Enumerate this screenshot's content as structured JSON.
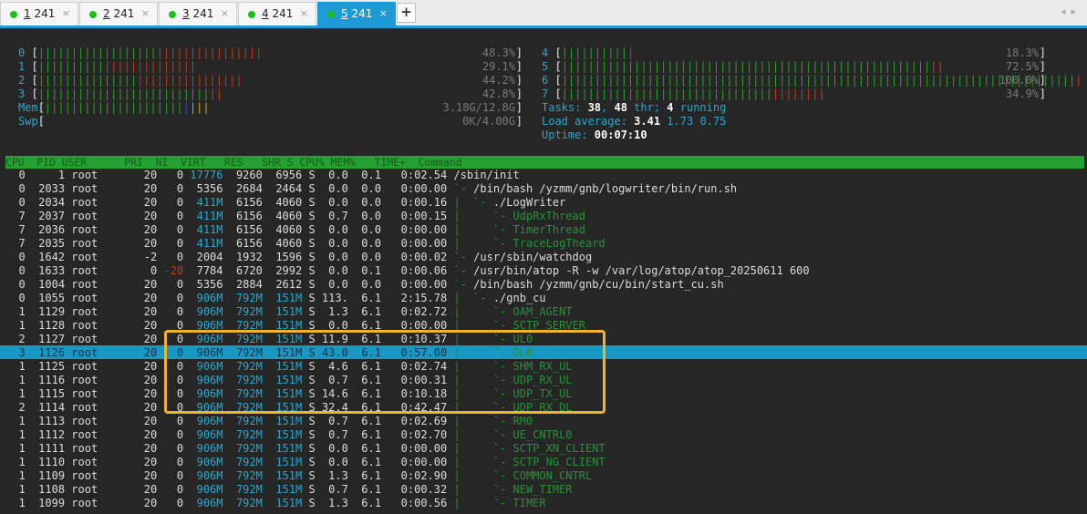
{
  "tabs": [
    {
      "num": "1",
      "name": " 241"
    },
    {
      "num": "2",
      "name": " 241"
    },
    {
      "num": "3",
      "name": " 241"
    },
    {
      "num": "4",
      "name": " 241"
    },
    {
      "num": "5",
      "name": " 241"
    }
  ],
  "active_tab": 4,
  "add_tab_label": "+",
  "scroll_arrows": "◂▸",
  "colors": {
    "accent": "#1e9ad6",
    "status_dot": "#1bc11b",
    "header_bar": "#27a033",
    "selected_row": "#1799c4",
    "highlight_box": "#f0b42a"
  },
  "cpus_left": [
    {
      "n": "0",
      "green": "||||||||||||||||||",
      "blue": "",
      "red": "||||||||||||||||",
      "yellow": "",
      "value": "48.3%"
    },
    {
      "n": "1",
      "green": "||||||||||",
      "blue": "",
      "red": "||||||||||||||",
      "yellow": "",
      "value": "29.1%"
    },
    {
      "n": "2",
      "green": "|||||||||||||||",
      "blue": "",
      "red": "||||||||||||||||",
      "yellow": "",
      "value": "44.2%"
    },
    {
      "n": "3",
      "green": "||||||||||||||||||||||||||",
      "blue": "",
      "red": "||",
      "yellow": "",
      "value": "42.8%"
    }
  ],
  "mem": {
    "label": "Mem",
    "green": "|||||||||||||||||||||",
    "blue": "|",
    "red": "",
    "yellow": "|||",
    "value": "3.18G/12.8G"
  },
  "swp": {
    "label": "Swp",
    "green": "",
    "blue": "",
    "red": "",
    "yellow": "",
    "value": "0K/4.00G"
  },
  "cpus_right": [
    {
      "n": "4",
      "green": "||||||||||",
      "blue": "",
      "red": "|",
      "yellow": "",
      "value": "18.3%"
    },
    {
      "n": "5",
      "green": "||||||||||||||||||||||||||||||||||||||||||||||||||||||||",
      "blue": "",
      "red": "||",
      "yellow": "",
      "value": "72.5%"
    },
    {
      "n": "6",
      "green": "||||||||||||||||||||||||||||||||||||||||||||||||||||||||||||||||||||||||||||||",
      "blue": "",
      "red": "|",
      "yellow": "",
      "value": "100.0%"
    },
    {
      "n": "7",
      "green": "||||||||||||||||||||||||||||||||",
      "blue": "",
      "red": "||||||||",
      "yellow": "",
      "value": "34.9%"
    }
  ],
  "tasks": {
    "label": "Tasks: ",
    "procs": "38",
    "sep": ", ",
    "threads": "48",
    "thr": " thr; ",
    "running": "4",
    "run_label": " running"
  },
  "load": {
    "label": "Load average: ",
    "one": "3.41",
    "five": "1.73",
    "fifteen": "0.75"
  },
  "uptime": {
    "label": "Uptime: ",
    "value": "00:07:10"
  },
  "header": "CPU  PID USER      PRI  NI  VIRT   RES   SHR S CPU% MEM%   TIME+  Command",
  "processes": [
    {
      "cpu": "0",
      "pid": "1",
      "user": "root",
      "pri": "20",
      "ni": "0",
      "virt": "17776",
      "res": "9260",
      "shr": "6956",
      "s": "S",
      "cpup": "0.0",
      "memp": "0.1",
      "time": "0:02.54",
      "tree": "",
      "cmd": "/sbin/init",
      "thread": false
    },
    {
      "cpu": "0",
      "pid": "2033",
      "user": "root",
      "pri": "20",
      "ni": "0",
      "virt": "5356",
      "res": "2684",
      "shr": "2464",
      "s": "S",
      "cpup": "0.0",
      "memp": "0.0",
      "time": "0:00.00",
      "tree": "`- ",
      "cmd": "/bin/bash /yzmm/gnb/logwriter/bin/run.sh",
      "thread": false
    },
    {
      "cpu": "0",
      "pid": "2034",
      "user": "root",
      "pri": "20",
      "ni": "0",
      "virt": "411M",
      "res": "6156",
      "shr": "4060",
      "s": "S",
      "cpup": "0.0",
      "memp": "0.0",
      "time": "0:00.16",
      "tree": "|  `- ",
      "cmd": "./LogWriter",
      "thread": false
    },
    {
      "cpu": "7",
      "pid": "2037",
      "user": "root",
      "pri": "20",
      "ni": "0",
      "virt": "411M",
      "res": "6156",
      "shr": "4060",
      "s": "S",
      "cpup": "0.7",
      "memp": "0.0",
      "time": "0:00.15",
      "tree": "|     `- ",
      "cmd": "UdpRxThread",
      "thread": true
    },
    {
      "cpu": "7",
      "pid": "2036",
      "user": "root",
      "pri": "20",
      "ni": "0",
      "virt": "411M",
      "res": "6156",
      "shr": "4060",
      "s": "S",
      "cpup": "0.0",
      "memp": "0.0",
      "time": "0:00.00",
      "tree": "|     `- ",
      "cmd": "TimerThread",
      "thread": true
    },
    {
      "cpu": "7",
      "pid": "2035",
      "user": "root",
      "pri": "20",
      "ni": "0",
      "virt": "411M",
      "res": "6156",
      "shr": "4060",
      "s": "S",
      "cpup": "0.0",
      "memp": "0.0",
      "time": "0:00.00",
      "tree": "|     `- ",
      "cmd": "TraceLogTheard",
      "thread": true
    },
    {
      "cpu": "0",
      "pid": "1642",
      "user": "root",
      "pri": "-2",
      "ni": "0",
      "virt": "2004",
      "res": "1932",
      "shr": "1596",
      "s": "S",
      "cpup": "0.0",
      "memp": "0.0",
      "time": "0:00.02",
      "tree": "`- ",
      "cmd": "/usr/sbin/watchdog",
      "thread": false
    },
    {
      "cpu": "0",
      "pid": "1633",
      "user": "root",
      "pri": "0",
      "ni": "-20",
      "virt": "7784",
      "res": "6720",
      "shr": "2992",
      "s": "S",
      "cpup": "0.0",
      "memp": "0.1",
      "time": "0:00.06",
      "tree": "`- ",
      "cmd": "/usr/bin/atop -R -w /var/log/atop/atop_20250611 600",
      "thread": false
    },
    {
      "cpu": "0",
      "pid": "1004",
      "user": "root",
      "pri": "20",
      "ni": "0",
      "virt": "5356",
      "res": "2884",
      "shr": "2612",
      "s": "S",
      "cpup": "0.0",
      "memp": "0.0",
      "time": "0:00.00",
      "tree": "`- ",
      "cmd": "/bin/bash /yzmm/gnb/cu/bin/start_cu.sh",
      "thread": false
    },
    {
      "cpu": "0",
      "pid": "1055",
      "user": "root",
      "pri": "20",
      "ni": "0",
      "virt": "906M",
      "res": "792M",
      "shr": "151M",
      "s": "S",
      "cpup": "113.",
      "memp": "6.1",
      "time": "2:15.78",
      "tree": "|  `- ",
      "cmd": "./gnb_cu",
      "thread": false
    },
    {
      "cpu": "1",
      "pid": "1129",
      "user": "root",
      "pri": "20",
      "ni": "0",
      "virt": "906M",
      "res": "792M",
      "shr": "151M",
      "s": "S",
      "cpup": "1.3",
      "memp": "6.1",
      "time": "0:02.72",
      "tree": "|     `- ",
      "cmd": "OAM_AGENT",
      "thread": true
    },
    {
      "cpu": "1",
      "pid": "1128",
      "user": "root",
      "pri": "20",
      "ni": "0",
      "virt": "906M",
      "res": "792M",
      "shr": "151M",
      "s": "S",
      "cpup": "0.0",
      "memp": "6.1",
      "time": "0:00.00",
      "tree": "|     `- ",
      "cmd": "SCTP_SERVER",
      "thread": true
    },
    {
      "cpu": "2",
      "pid": "1127",
      "user": "root",
      "pri": "20",
      "ni": "0",
      "virt": "906M",
      "res": "792M",
      "shr": "151M",
      "s": "S",
      "cpup": "11.9",
      "memp": "6.1",
      "time": "0:10.37",
      "tree": "|     `- ",
      "cmd": "UL0",
      "thread": true
    },
    {
      "cpu": "3",
      "pid": "1126",
      "user": "root",
      "pri": "20",
      "ni": "0",
      "virt": "906M",
      "res": "792M",
      "shr": "151M",
      "s": "S",
      "cpup": "43.0",
      "memp": "6.1",
      "time": "0:57.00",
      "tree": "|     `- ",
      "cmd": "DL0",
      "thread": true
    },
    {
      "cpu": "1",
      "pid": "1125",
      "user": "root",
      "pri": "20",
      "ni": "0",
      "virt": "906M",
      "res": "792M",
      "shr": "151M",
      "s": "S",
      "cpup": "4.6",
      "memp": "6.1",
      "time": "0:02.74",
      "tree": "|     `- ",
      "cmd": "SHM_RX_UL",
      "thread": true
    },
    {
      "cpu": "1",
      "pid": "1116",
      "user": "root",
      "pri": "20",
      "ni": "0",
      "virt": "906M",
      "res": "792M",
      "shr": "151M",
      "s": "S",
      "cpup": "0.7",
      "memp": "6.1",
      "time": "0:00.31",
      "tree": "|     `- ",
      "cmd": "UDP_RX_UL",
      "thread": true
    },
    {
      "cpu": "1",
      "pid": "1115",
      "user": "root",
      "pri": "20",
      "ni": "0",
      "virt": "906M",
      "res": "792M",
      "shr": "151M",
      "s": "S",
      "cpup": "14.6",
      "memp": "6.1",
      "time": "0:10.18",
      "tree": "|     `- ",
      "cmd": "UDP_TX_UL",
      "thread": true
    },
    {
      "cpu": "2",
      "pid": "1114",
      "user": "root",
      "pri": "20",
      "ni": "0",
      "virt": "906M",
      "res": "792M",
      "shr": "151M",
      "s": "S",
      "cpup": "32.4",
      "memp": "6.1",
      "time": "0:42.47",
      "tree": "|     `- ",
      "cmd": "UDP_RX_DL",
      "thread": true
    },
    {
      "cpu": "1",
      "pid": "1113",
      "user": "root",
      "pri": "20",
      "ni": "0",
      "virt": "906M",
      "res": "792M",
      "shr": "151M",
      "s": "S",
      "cpup": "0.7",
      "memp": "6.1",
      "time": "0:02.69",
      "tree": "|     `- ",
      "cmd": "RM0",
      "thread": true
    },
    {
      "cpu": "1",
      "pid": "1112",
      "user": "root",
      "pri": "20",
      "ni": "0",
      "virt": "906M",
      "res": "792M",
      "shr": "151M",
      "s": "S",
      "cpup": "0.7",
      "memp": "6.1",
      "time": "0:02.70",
      "tree": "|     `- ",
      "cmd": "UE_CNTRL0",
      "thread": true
    },
    {
      "cpu": "1",
      "pid": "1111",
      "user": "root",
      "pri": "20",
      "ni": "0",
      "virt": "906M",
      "res": "792M",
      "shr": "151M",
      "s": "S",
      "cpup": "0.0",
      "memp": "6.1",
      "time": "0:00.00",
      "tree": "|     `- ",
      "cmd": "SCTP_XN_CLIENT",
      "thread": true
    },
    {
      "cpu": "1",
      "pid": "1110",
      "user": "root",
      "pri": "20",
      "ni": "0",
      "virt": "906M",
      "res": "792M",
      "shr": "151M",
      "s": "S",
      "cpup": "0.0",
      "memp": "6.1",
      "time": "0:00.00",
      "tree": "|     `- ",
      "cmd": "SCTP_NG_CLIENT",
      "thread": true
    },
    {
      "cpu": "1",
      "pid": "1109",
      "user": "root",
      "pri": "20",
      "ni": "0",
      "virt": "906M",
      "res": "792M",
      "shr": "151M",
      "s": "S",
      "cpup": "1.3",
      "memp": "6.1",
      "time": "0:02.90",
      "tree": "|     `- ",
      "cmd": "COMMON_CNTRL",
      "thread": true
    },
    {
      "cpu": "1",
      "pid": "1108",
      "user": "root",
      "pri": "20",
      "ni": "0",
      "virt": "906M",
      "res": "792M",
      "shr": "151M",
      "s": "S",
      "cpup": "0.7",
      "memp": "6.1",
      "time": "0:00.32",
      "tree": "|     `- ",
      "cmd": "NEW_TIMER",
      "thread": true
    },
    {
      "cpu": "1",
      "pid": "1099",
      "user": "root",
      "pri": "20",
      "ni": "0",
      "virt": "906M",
      "res": "792M",
      "shr": "151M",
      "s": "S",
      "cpup": "1.3",
      "memp": "6.1",
      "time": "0:00.56",
      "tree": "|     `- ",
      "cmd": "TIMER",
      "thread": true
    }
  ],
  "selected_pid": "1126"
}
